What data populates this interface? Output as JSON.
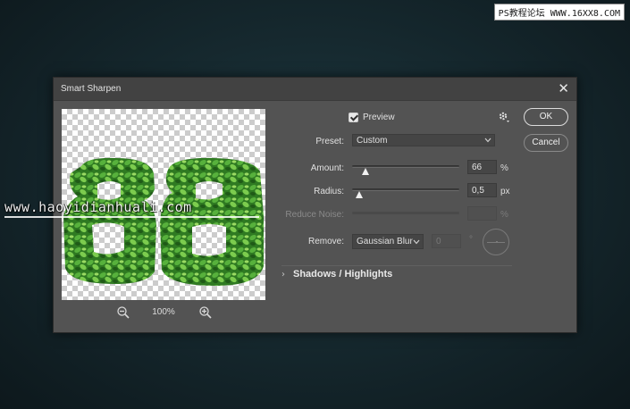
{
  "dialog": {
    "title": "Smart Sharpen",
    "close_icon": "close-icon"
  },
  "preview": {
    "checkbox_checked": true,
    "label": "Preview",
    "zoom_level": "100%",
    "zoom_out_icon": "zoom-out-icon",
    "zoom_in_icon": "zoom-in-icon"
  },
  "settings": {
    "gear_icon": "gear-icon",
    "preset": {
      "label": "Preset:",
      "value": "Custom"
    },
    "amount": {
      "label": "Amount:",
      "value": "66",
      "unit": "%",
      "slider_fraction": 0.13
    },
    "radius": {
      "label": "Radius:",
      "value": "0,5",
      "unit": "px",
      "slider_fraction": 0.07
    },
    "reduce_noise": {
      "label": "Reduce Noise:",
      "value": "",
      "unit": "%"
    },
    "remove": {
      "label": "Remove:",
      "value": "Gaussian Blur",
      "angle_value": "0",
      "angle_unit": "°"
    },
    "shadows_highlights": {
      "label": "Shadows / Highlights"
    }
  },
  "buttons": {
    "ok_label": "OK",
    "cancel_label": "Cancel"
  },
  "watermarks": {
    "top": "PS教程论坛 WWW.16XX8.COM",
    "middle": "www.haoyidianhuali.com"
  },
  "colors": {
    "dialog_bg": "#535353",
    "titlebar_bg": "#424242",
    "leaf_green": "#3e8f2c"
  }
}
